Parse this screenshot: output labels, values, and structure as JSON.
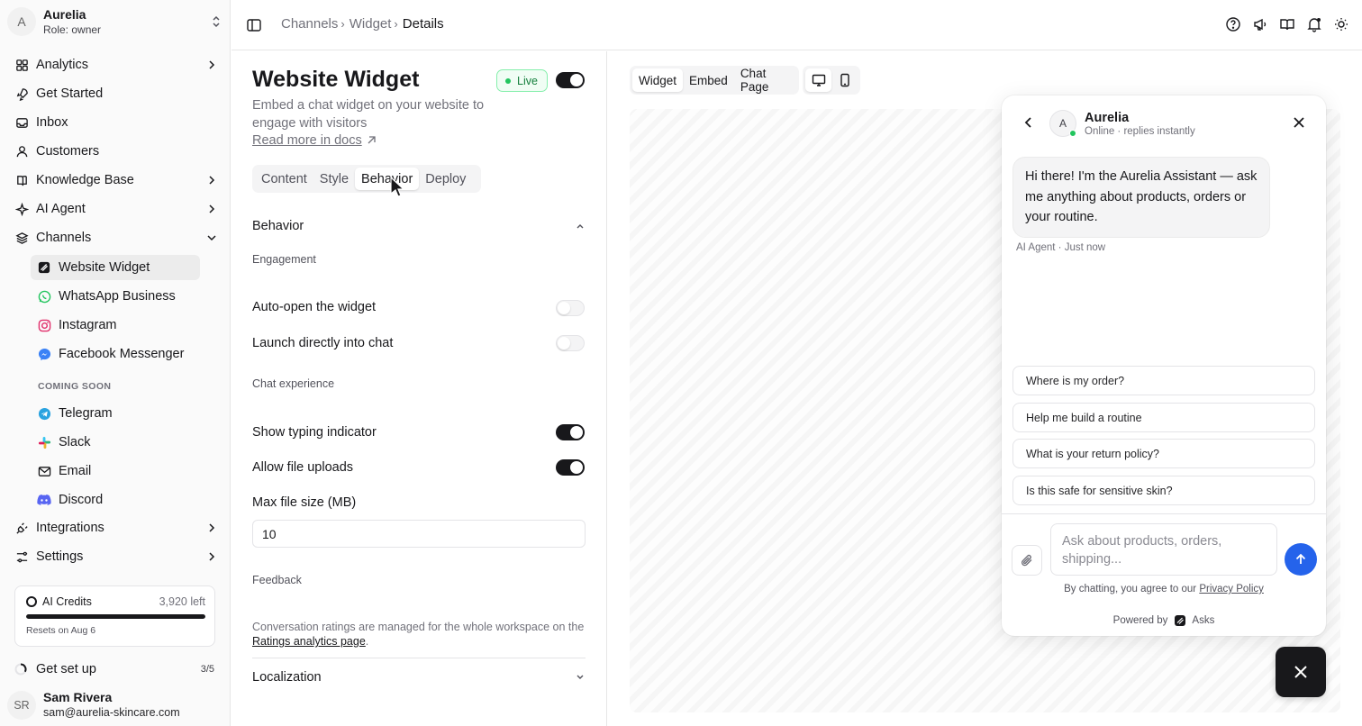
{
  "workspace": {
    "initial": "A",
    "name": "Aurelia",
    "role": "Role: owner"
  },
  "sidebar": {
    "items": [
      {
        "label": "Analytics",
        "icon": "grid-icon"
      },
      {
        "label": "Get Started",
        "icon": "rocket-icon"
      },
      {
        "label": "Inbox",
        "icon": "inbox-icon"
      },
      {
        "label": "Customers",
        "icon": "user-icon"
      },
      {
        "label": "Knowledge Base",
        "icon": "book-icon"
      },
      {
        "label": "AI Agent",
        "icon": "sparkle-icon"
      },
      {
        "label": "Channels",
        "icon": "layers-icon"
      },
      {
        "label": "Integrations",
        "icon": "plug-icon"
      },
      {
        "label": "Settings",
        "icon": "sliders-icon"
      }
    ],
    "channels": [
      {
        "label": "Website Widget",
        "icon": "widget-icon"
      },
      {
        "label": "WhatsApp Business",
        "icon": "whatsapp-icon"
      },
      {
        "label": "Instagram",
        "icon": "instagram-icon"
      },
      {
        "label": "Facebook Messenger",
        "icon": "messenger-icon"
      }
    ],
    "coming_soon_label": "COMING SOON",
    "coming_soon": [
      {
        "label": "Telegram",
        "icon": "telegram-icon"
      },
      {
        "label": "Slack",
        "icon": "slack-icon"
      },
      {
        "label": "Email",
        "icon": "mail-icon"
      },
      {
        "label": "Discord",
        "icon": "discord-icon"
      }
    ],
    "credits": {
      "label": "AI Credits",
      "left": "3,920 left",
      "reset": "Resets on Aug 6",
      "fraction": 1.0
    },
    "setup": {
      "label": "Get set up",
      "count": "3/5"
    },
    "user": {
      "initials": "SR",
      "name": "Sam Rivera",
      "email": "sam@aurelia-skincare.com"
    }
  },
  "breadcrumb": [
    "Channels",
    "Widget",
    "Details"
  ],
  "panel": {
    "title": "Website Widget",
    "live_badge": "Live",
    "description": "Embed a chat widget on your website to engage with visitors",
    "docs_link": "Read more in docs",
    "tabs": [
      "Content",
      "Style",
      "Behavior",
      "Deploy"
    ],
    "active_tab": "Behavior",
    "section_behavior": "Behavior",
    "group_engagement": "Engagement",
    "auto_open": "Auto-open the widget",
    "launch_chat": "Launch directly into chat",
    "group_chat": "Chat experience",
    "typing": "Show typing indicator",
    "uploads": "Allow file uploads",
    "max_file_label": "Max file size (MB)",
    "max_file_value": "10",
    "group_feedback": "Feedback",
    "feedback_note": "Conversation ratings are managed for the whole workspace on the",
    "feedback_link": "Ratings analytics page",
    "section_localization": "Localization",
    "toggles": {
      "live": true,
      "auto_open": false,
      "launch_chat": false,
      "typing": true,
      "uploads": true
    }
  },
  "preview": {
    "tabs": [
      "Widget",
      "Embed",
      "Chat Page"
    ],
    "active_tab": "Widget",
    "devices": [
      "desktop-icon",
      "mobile-icon"
    ]
  },
  "chat": {
    "avatar": "A",
    "name": "Aurelia",
    "status": "Online · replies instantly",
    "greeting": "Hi there! I'm the Aurelia Assistant — ask me anything about products, orders or your routine.",
    "meta": "AI Agent · Just now",
    "suggestions": [
      "Where is my order?",
      "Help me build a routine",
      "What is your return policy?",
      "Is this safe for sensitive skin?"
    ],
    "input_placeholder": "Ask about products, orders, shipping...",
    "legal_prefix": "By chatting, you agree to our",
    "legal_link": "Privacy Policy",
    "powered_prefix": "Powered by",
    "powered_brand": "Asks",
    "accent": "#2563eb"
  }
}
